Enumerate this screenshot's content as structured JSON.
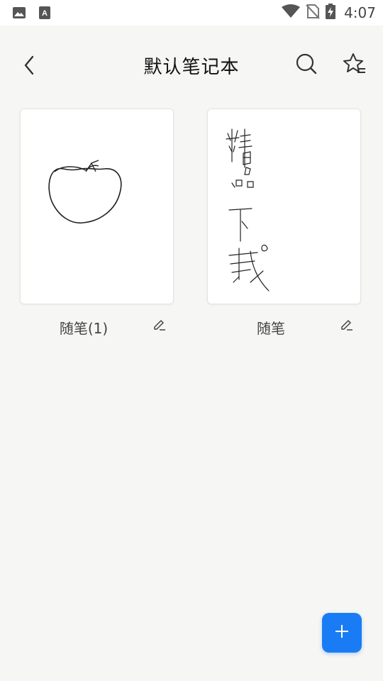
{
  "status_bar": {
    "time": "4:07",
    "left_icons": [
      "image-notification-icon",
      "text-notification-icon"
    ],
    "right_icons": [
      "wifi-icon",
      "no-sim-icon",
      "battery-charging-icon"
    ]
  },
  "header": {
    "title": "默认笔记本",
    "back_icon": "chevron-left-icon",
    "search_icon": "search-icon",
    "favorite_icon": "star-filter-icon"
  },
  "notes": [
    {
      "title": "随笔(1)",
      "thumbnail": "apple-sketch"
    },
    {
      "title": "随笔",
      "thumbnail": "handwriting-sketch"
    }
  ],
  "fab": {
    "icon": "plus-icon"
  },
  "colors": {
    "accent": "#1a7cf5",
    "background": "#f6f6f4"
  }
}
